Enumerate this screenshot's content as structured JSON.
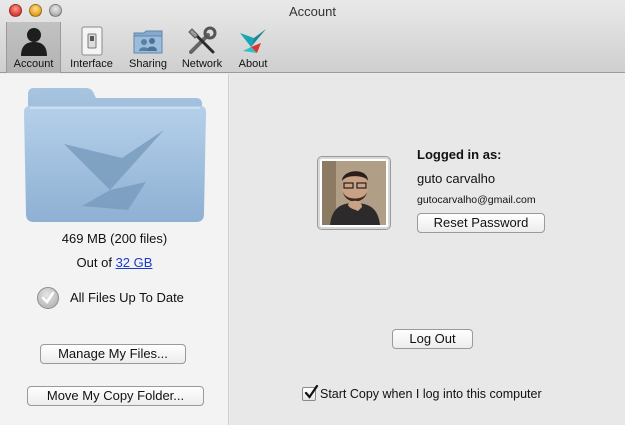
{
  "window": {
    "title": "Account"
  },
  "toolbar": {
    "items": [
      {
        "label": "Account",
        "icon": "account-icon",
        "active": true
      },
      {
        "label": "Interface",
        "icon": "interface-icon",
        "active": false
      },
      {
        "label": "Sharing",
        "icon": "sharing-icon",
        "active": false
      },
      {
        "label": "Network",
        "icon": "network-icon",
        "active": false
      },
      {
        "label": "About",
        "icon": "about-icon",
        "active": false
      }
    ]
  },
  "storage": {
    "usage_text": "469 MB (200 files)",
    "out_of_prefix": "Out of ",
    "total_link": "32 GB",
    "status": "All Files Up To Date"
  },
  "buttons": {
    "manage_files": "Manage My Files...",
    "move_folder": "Move My Copy Folder...",
    "reset_password": "Reset Password",
    "log_out": "Log Out"
  },
  "account": {
    "logged_in_label": "Logged in as:",
    "name": "guto carvalho",
    "email": "gutocarvalho@gmail.com"
  },
  "startup": {
    "checked": true,
    "label": "Start Copy when I log into this computer"
  },
  "colors": {
    "folder_blue": "#8fb3d6",
    "link_blue": "#1a3cc7",
    "about_icon_teal": "#1aa7b5",
    "about_icon_red": "#d9382e"
  }
}
